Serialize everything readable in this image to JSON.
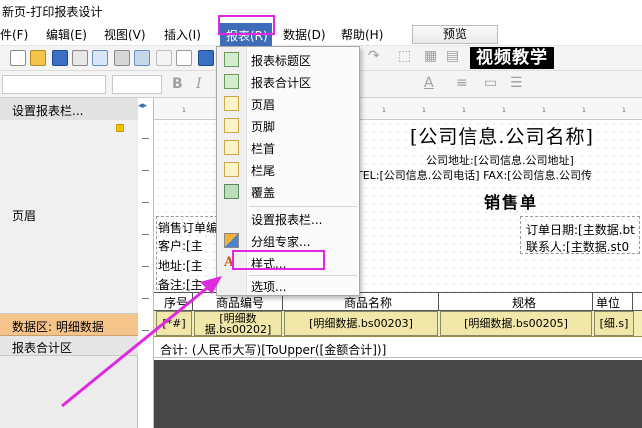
{
  "window": {
    "title": "新页-打印报表设计"
  },
  "menu": {
    "items": [
      {
        "label": "件(F)"
      },
      {
        "label": "编辑(E)"
      },
      {
        "label": "视图(V)"
      },
      {
        "label": "插入(I)"
      },
      {
        "label": "报表(R)"
      },
      {
        "label": "数据(D)"
      },
      {
        "label": "帮助(H)"
      }
    ],
    "preview_label": "预览"
  },
  "toolbar": {
    "brand_label": "视频教学",
    "bold_label": "B",
    "italic_label": "I",
    "font_color_label": "A"
  },
  "band_panel": {
    "title": "设置报表栏...",
    "header_label": "页眉",
    "data_label": "数据区: 明细数据",
    "total_label": "报表合计区"
  },
  "report_menu": {
    "items": [
      {
        "label": "报表标题区",
        "icon": "report-title-icon"
      },
      {
        "label": "报表合计区",
        "icon": "report-total-icon"
      },
      {
        "label": "页眉",
        "icon": "page-header-icon"
      },
      {
        "label": "页脚",
        "icon": "page-footer-icon"
      },
      {
        "label": "栏首",
        "icon": "column-header-icon"
      },
      {
        "label": "栏尾",
        "icon": "column-footer-icon"
      },
      {
        "label": "覆盖",
        "icon": "overlay-icon"
      },
      {
        "label": "设置报表栏...",
        "icon": ""
      },
      {
        "label": "分组专家...",
        "icon": "group-expert-icon"
      },
      {
        "label": "样式...",
        "icon": "style-icon"
      },
      {
        "label": "选项...",
        "icon": ""
      }
    ]
  },
  "canvas": {
    "company_name": "[公司信息.公司名称]",
    "company_address": "公司地址:[公司信息.公司地址]",
    "tel_fax": "TEL:[公司信息.公司电话]  FAX:[公司信息.公司传",
    "report_title": "销售单",
    "left_labels": [
      "销售订单编",
      "客户:[主",
      "地址:[主",
      "备注:[主"
    ],
    "order_date": "订单日期:[主数据.bt",
    "contact": "联系人:[主数据.st0",
    "table_headers": [
      "序号",
      "商品编号",
      "商品名称",
      "规格",
      "单位"
    ],
    "row_cells": [
      "[*#]",
      "[明细数据.bs00202]",
      "[明细数据.bs00203]",
      "[明细数据.bs00205]",
      "[细.s]"
    ],
    "sum_text": "合计: (人民币大写)[ToUpper([金额合计])]"
  },
  "colors": {
    "menu_active": "#3e6cb8",
    "highlight": "#e028e0",
    "data_band": "#f5c48a",
    "data_row": "#f0e7a8"
  }
}
